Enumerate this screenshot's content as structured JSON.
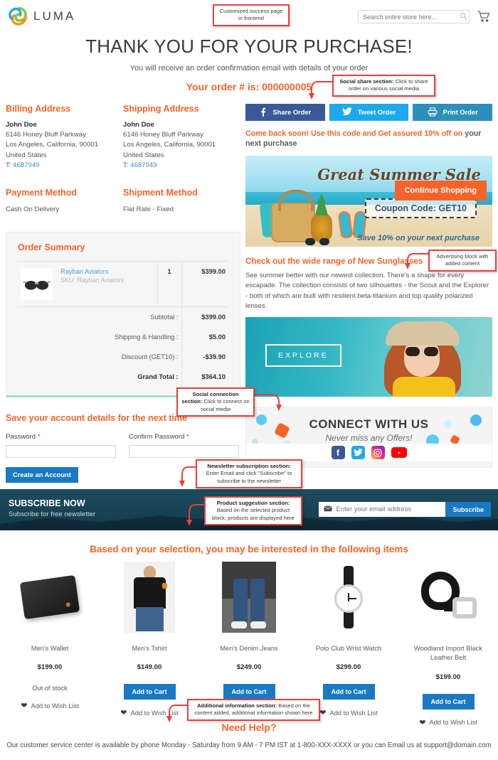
{
  "header": {
    "logo_text": "LUMA",
    "logo_icon": "luma-flower-icon",
    "search_placeholder": "Search entire store here...",
    "search_value": "",
    "search_icon": "search-icon",
    "cart_icon": "shopping-cart-icon"
  },
  "success": {
    "title": "THANK YOU FOR YOUR PURCHASE!",
    "subtitle": "You will receive an order confirmation email with details of your order",
    "order_number_line": "Your order # is: 000000005"
  },
  "billing": {
    "heading": "Billing Address",
    "name": "John Doe",
    "street": "6146 Honey Bluff Parkway",
    "citystate": "Los Angeles, California, 90001",
    "country": "United States",
    "tel_label": "T:",
    "tel": "4687949"
  },
  "shipping": {
    "heading": "Shipping Address",
    "name": "John Doe",
    "street": "6146 Honey Bluff Parkway",
    "citystate": "Los Angeles, California, 90001",
    "country": "United States",
    "tel_label": "T:",
    "tel": "4687949"
  },
  "payment": {
    "heading": "Payment Method",
    "value": "Cash On Delivery"
  },
  "shipment": {
    "heading": "Shipment Method",
    "value": "Flat Rate - Fixed"
  },
  "order_summary": {
    "heading": "Order Summary",
    "item": {
      "name": "Rayban Aviators",
      "sku": "SKU: Rayban Aviators",
      "qty": "1",
      "price": "$399.00",
      "image_icon": "sunglasses-product-image"
    },
    "totals": [
      {
        "label": "Subtotal :",
        "value": "$399.00"
      },
      {
        "label": "Shipping & Handling :",
        "value": "$5.00"
      },
      {
        "label": "Discount (GET10) :",
        "value": "-$39.90"
      },
      {
        "label": "Grand Total :",
        "value": "$364.10"
      }
    ]
  },
  "account": {
    "heading": "Save your account details for the next time",
    "password_label": "Password",
    "confirm_label": "Confirm Password",
    "required_mark": "*",
    "password_value": "",
    "confirm_value": "",
    "create_button": "Create an Account"
  },
  "social_share": {
    "buttons": [
      {
        "label": "Share Order",
        "icon": "facebook-icon",
        "color": "#3b5998"
      },
      {
        "label": "Tweet Order",
        "icon": "twitter-icon",
        "color": "#1da9ec"
      },
      {
        "label": "Print Order",
        "icon": "printer-icon",
        "color": "#2e8fbb"
      }
    ]
  },
  "promo": {
    "text_part1": "Come back soon! Use this code and Get assured 10% off on",
    "text_part2": "your next purchase"
  },
  "summer_banner": {
    "title": "Great Summer Sale",
    "coupon": "Coupon Code: GET10",
    "save_text": "Save 10% on your next purchase"
  },
  "ad_block": {
    "heading": "Check out the wide range of New Sunglasses",
    "body": "See summer better with our newest collection. There's a shape for every escapade. The collection consists of two silhouettes - the Scout and the Explorer - both of which are built with resilient beta-titanium and top quality polarized lenses.",
    "cta": "EXPLORE"
  },
  "connect": {
    "title": "CONNECT WITH US",
    "subtitle": "Never miss any Offers!",
    "icons": [
      {
        "name": "facebook-icon",
        "glyph": "f"
      },
      {
        "name": "twitter-icon",
        "glyph": "t"
      },
      {
        "name": "instagram-icon",
        "glyph": "ig"
      },
      {
        "name": "youtube-icon",
        "glyph": "yt"
      }
    ]
  },
  "continue_button": "Continue Shopping",
  "subscribe": {
    "title": "SUBSCRIBE NOW",
    "subtitle": "Subscribe for free newsletter",
    "placeholder": "Enter your email address",
    "value": "",
    "button": "Subscribe",
    "mail_icon": "envelope-icon"
  },
  "recommendations": {
    "title": "Based on your selection, you may be interested in the following items",
    "wish_label": "Add to Wish List",
    "wish_icon": "heart-icon",
    "products": [
      {
        "name": "Men's Wallet",
        "price": "$199.00",
        "action": "Out of stock",
        "in_stock": false,
        "image_icon": "wallet-image"
      },
      {
        "name": "Men's Tshirt",
        "price": "$149.00",
        "action": "Add to Cart",
        "in_stock": true,
        "image_icon": "tshirt-image"
      },
      {
        "name": "Men's Denim Jeans",
        "price": "$249.00",
        "action": "Add to Cart",
        "in_stock": true,
        "image_icon": "jeans-image"
      },
      {
        "name": "Polo Club Wrist Watch",
        "price": "$299.00",
        "action": "Add to Cart",
        "in_stock": true,
        "image_icon": "watch-image"
      },
      {
        "name": "Woodland Import Black Leather Belt",
        "price": "$199.00",
        "action": "Add to Cart",
        "in_stock": true,
        "image_icon": "belt-image"
      }
    ]
  },
  "need_help": {
    "title": "Need Help?",
    "text": "Our customer service center is available by phone Monday - Saturday from 9 AM - 7 PM IST at 1-800-XXX-XXXX or you can Email us at support@domain.com"
  },
  "annotations": {
    "customized_page": "Customized success page in frontend",
    "social_share_bold": "Social share section:",
    "social_share_rest": " Click to share order on various social media",
    "advertising": "Advertising block with added content",
    "social_connection_bold": "Social connection section:",
    "social_connection_rest": " Click to connect on social media",
    "newsletter_bold": "Newsletter subscription section:",
    "newsletter_rest": " Enter Email and click \"Subscribe\" to subscribe to the newsletter",
    "product_suggestion_bold": "Product suggestion section:",
    "product_suggestion_rest": " Based on the selected product block, products are displayed here",
    "additional_info_bold": "Additional information section:",
    "additional_info_rest": " Based on the content added, additional information shown here"
  },
  "colors": {
    "accent_orange": "#f4642a",
    "link_blue": "#1979c3",
    "annotation_red": "#e8403a",
    "facebook": "#3b5998",
    "twitter": "#1da9ec",
    "print": "#2e8fbb"
  }
}
